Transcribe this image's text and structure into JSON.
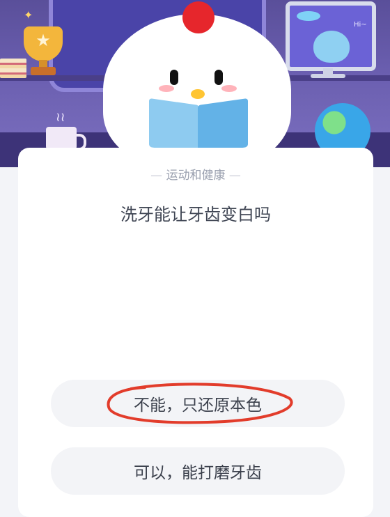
{
  "header": {
    "monitor_greeting": "Hi~"
  },
  "quiz": {
    "category": "运动和健康",
    "question": "洗牙能让牙齿变白吗",
    "options": [
      {
        "label": "不能，只还原本色",
        "marked": true
      },
      {
        "label": "可以，能打磨牙齿",
        "marked": false
      }
    ]
  },
  "colors": {
    "accent_red": "#e23c2b",
    "option_bg": "#f3f4f7",
    "banner_purple": "#6b5fb0"
  }
}
